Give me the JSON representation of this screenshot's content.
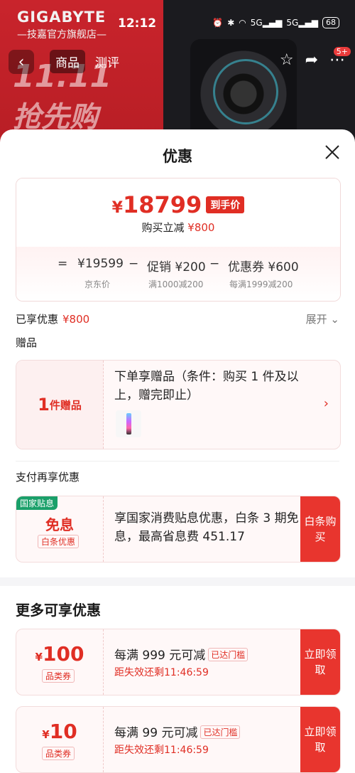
{
  "status_bar": {
    "time": "12:12",
    "battery": "68",
    "net1": "5G",
    "net2": "5G"
  },
  "background": {
    "brand": "GIGABYTE",
    "brand_sub": "—技嘉官方旗舰店—",
    "promo_line1": "11.11",
    "promo_line2": "抢先购"
  },
  "nav": {
    "tabs": [
      {
        "label": "商品",
        "active": true
      },
      {
        "label": "测评",
        "active": false
      }
    ],
    "badge": "5+"
  },
  "sheet": {
    "title": "优惠",
    "final_price": {
      "currency": "¥",
      "value": "18799",
      "tag": "到手价"
    },
    "reduce_text": "购买立减",
    "reduce_amount": "¥800",
    "formula": {
      "eq": "=",
      "jd_price": "¥19599",
      "minus1": "−",
      "promo": "促销 ¥200",
      "minus2": "−",
      "coupon": "优惠券 ¥600",
      "jd_label": "京东价",
      "promo_label": "满1000减200",
      "coupon_label": "每满1999减200"
    },
    "enjoyed_label": "已享优惠",
    "enjoyed_amount": "¥800",
    "expand_label": "展开",
    "gift_section": "赠品",
    "gift": {
      "count": "1",
      "unit": "件赠品",
      "desc": "下单享赠品（条件：购买 1 件及以上，赠完即止）"
    },
    "pay_section": "支付再享优惠",
    "pay": {
      "badge": "国家贴息",
      "big": "免息",
      "small": "白条优惠",
      "desc": "享国家消费贴息优惠，白条 3 期免息，最高省息费 451.17",
      "button": "白条购买"
    },
    "more_title": "更多可享优惠",
    "coupons": [
      {
        "currency": "¥",
        "amount": "100",
        "type": "品类券",
        "condition": "每满 999 元可减",
        "met": "已达门槛",
        "expire": "距失效还剩11:46:59",
        "button": "立即领取"
      },
      {
        "currency": "¥",
        "amount": "10",
        "type": "品类券",
        "condition": "每满 99 元可减",
        "met": "已达门槛",
        "expire": "距失效还剩11:46:59",
        "button": "立即领取"
      }
    ]
  },
  "colors": {
    "accent": "#e02e24",
    "button": "#e8352e",
    "badge_green": "#1aa06a"
  }
}
